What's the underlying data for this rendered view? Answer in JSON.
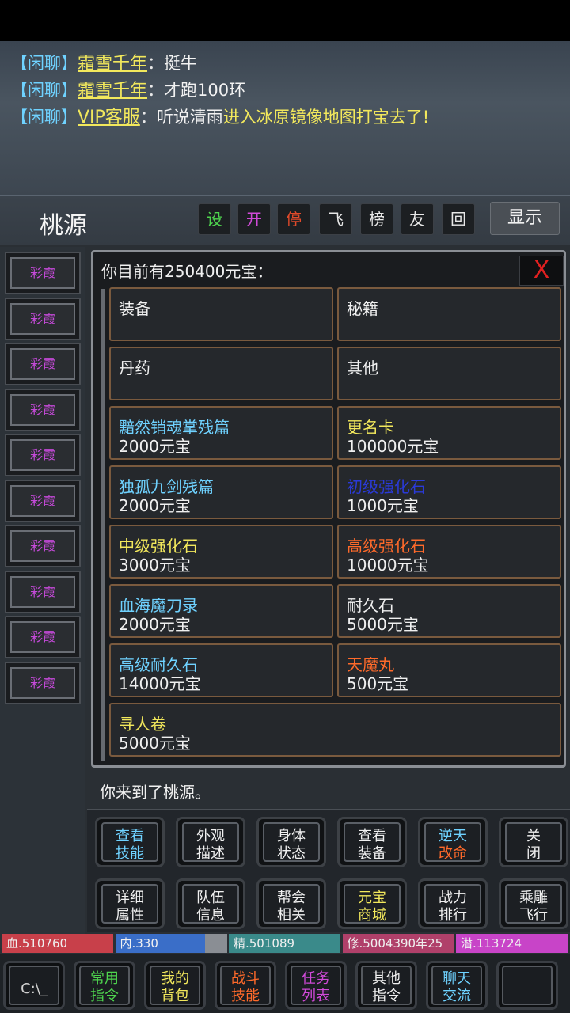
{
  "chat": [
    {
      "channel": "【闲聊】",
      "user": "霜雪千年",
      "sep": "：",
      "message": "挺牛",
      "highlight": ""
    },
    {
      "channel": "【闲聊】",
      "user": "霜雪千年",
      "sep": "：",
      "message": "才跑100环",
      "highlight": ""
    },
    {
      "channel": "【闲聊】",
      "user": "VIP客服",
      "sep": "：",
      "message": "听说清雨",
      "highlight": "进入冰原镜像地图打宝去了!"
    }
  ],
  "location": "桃源",
  "top_buttons": [
    {
      "label": "设",
      "color": "#4ed44e"
    },
    {
      "label": "开",
      "color": "#d04ad8"
    },
    {
      "label": "停",
      "color": "#e24a2a"
    },
    {
      "label": "飞",
      "color": "#e8e8e8"
    },
    {
      "label": "榜",
      "color": "#e8e8e8"
    },
    {
      "label": "友",
      "color": "#e8e8e8"
    },
    {
      "label": "回",
      "color": "#e8e8e8"
    }
  ],
  "show_button": "显示",
  "side_buttons": [
    "彩霞",
    "彩霞",
    "彩霞",
    "彩霞",
    "彩霞",
    "彩霞",
    "彩霞",
    "彩霞",
    "彩霞",
    "彩霞"
  ],
  "shop": {
    "title": "你目前有250400元宝：",
    "close_label": "X",
    "items": [
      {
        "name": "装备",
        "price": "",
        "color": "#f0f0f0"
      },
      {
        "name": "秘籍",
        "price": "",
        "color": "#f0f0f0"
      },
      {
        "name": "丹药",
        "price": "",
        "color": "#f0f0f0"
      },
      {
        "name": "其他",
        "price": "",
        "color": "#f0f0f0"
      },
      {
        "name": "黯然销魂掌残篇",
        "price": "2000元宝",
        "color": "#6fd2ff"
      },
      {
        "name": "更名卡",
        "price": "100000元宝",
        "color": "#f2e85c"
      },
      {
        "name": "独孤九剑残篇",
        "price": "2000元宝",
        "color": "#6fd2ff"
      },
      {
        "name": "初级强化石",
        "price": "1000元宝",
        "color": "#2a3ad8"
      },
      {
        "name": "中级强化石",
        "price": "3000元宝",
        "color": "#f2e85c"
      },
      {
        "name": "高级强化石",
        "price": "10000元宝",
        "color": "#ff6a2a"
      },
      {
        "name": "血海魔刀录",
        "price": "2000元宝",
        "color": "#6fd2ff"
      },
      {
        "name": "耐久石",
        "price": "5000元宝",
        "color": "#f0f0f0"
      },
      {
        "name": "高级耐久石",
        "price": "14000元宝",
        "color": "#6fd2ff"
      },
      {
        "name": "天魔丸",
        "price": "500元宝",
        "color": "#ff6a2a"
      },
      {
        "name": "寻人卷",
        "price": "5000元宝",
        "color": "#f2e85c"
      }
    ]
  },
  "log": "你来到了桃源。",
  "commands": [
    {
      "l1": "查看",
      "l2": "技能",
      "c1": "#6fd2ff",
      "c2": "#6fd2ff"
    },
    {
      "l1": "外观",
      "l2": "描述",
      "c1": "#f0f0f0",
      "c2": "#f0f0f0"
    },
    {
      "l1": "身体",
      "l2": "状态",
      "c1": "#f0f0f0",
      "c2": "#f0f0f0"
    },
    {
      "l1": "查看",
      "l2": "装备",
      "c1": "#f0f0f0",
      "c2": "#f0f0f0"
    },
    {
      "l1": "逆天",
      "l2": "改命",
      "c1": "#6fd2ff",
      "c2": "#ff6a2a"
    },
    {
      "l1": "关",
      "l2": "闭",
      "c1": "#f0f0f0",
      "c2": "#f0f0f0"
    },
    {
      "l1": "详细",
      "l2": "属性",
      "c1": "#f0f0f0",
      "c2": "#f0f0f0"
    },
    {
      "l1": "队伍",
      "l2": "信息",
      "c1": "#f0f0f0",
      "c2": "#f0f0f0"
    },
    {
      "l1": "帮会",
      "l2": "相关",
      "c1": "#f0f0f0",
      "c2": "#f0f0f0"
    },
    {
      "l1": "元宝",
      "l2": "商城",
      "c1": "#f2e85c",
      "c2": "#f2e85c"
    },
    {
      "l1": "战力",
      "l2": "排行",
      "c1": "#f0f0f0",
      "c2": "#f0f0f0"
    },
    {
      "l1": "乘雕",
      "l2": "飞行",
      "c1": "#f0f0f0",
      "c2": "#f0f0f0"
    }
  ],
  "stats": [
    {
      "label": "血.510760",
      "color": "#c8404a",
      "fill": 1.0
    },
    {
      "label": "内.330",
      "color": "#3a6ec8",
      "fill": 0.8
    },
    {
      "label": "精.501089",
      "color": "#3a8a8a",
      "fill": 1.0
    },
    {
      "label": "修.5004390年25",
      "color": "#b0406a",
      "fill": 1.0
    },
    {
      "label": "潜.113724",
      "color": "#c844c8",
      "fill": 1.0
    }
  ],
  "dock": [
    {
      "l1": "C:\\_",
      "l2": "",
      "color": "#d0d0d0",
      "icon": "terminal-icon"
    },
    {
      "l1": "常用",
      "l2": "指令",
      "color": "#4ed44e"
    },
    {
      "l1": "我的",
      "l2": "背包",
      "color": "#f2e85c"
    },
    {
      "l1": "战斗",
      "l2": "技能",
      "color": "#ff6a2a"
    },
    {
      "l1": "任务",
      "l2": "列表",
      "color": "#d04ad8"
    },
    {
      "l1": "其他",
      "l2": "指令",
      "color": "#f0f0f0"
    },
    {
      "l1": "聊天",
      "l2": "交流",
      "color": "#6fd2ff"
    },
    {
      "l1": "",
      "l2": "",
      "color": "#888",
      "icon": "logo-icon"
    }
  ]
}
